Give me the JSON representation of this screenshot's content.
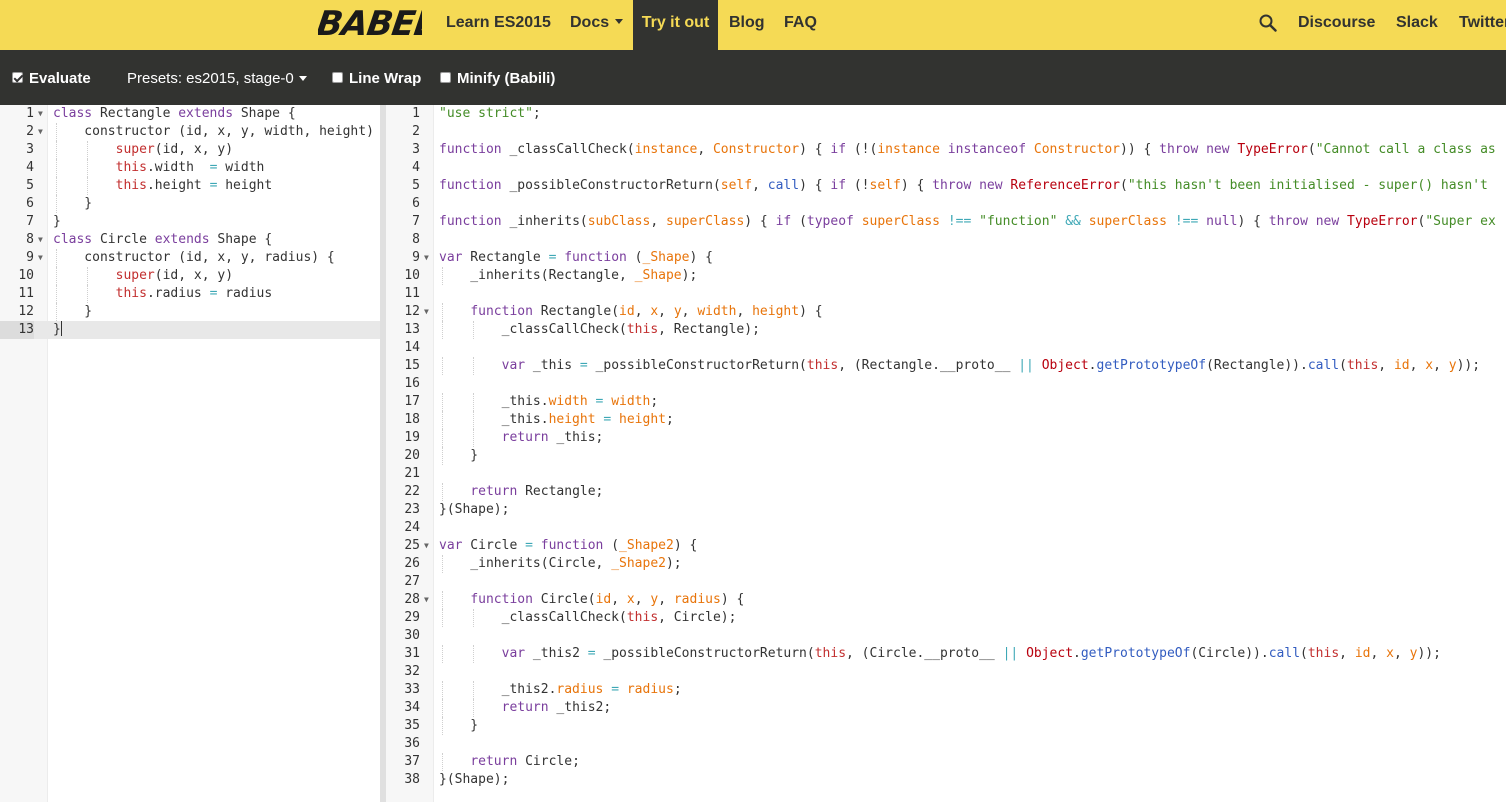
{
  "brand": {
    "logo_text": "BABEL"
  },
  "nav": {
    "items": [
      {
        "label": "Learn ES2015"
      },
      {
        "label": "Docs"
      },
      {
        "label": "Try it out"
      },
      {
        "label": "Blog"
      },
      {
        "label": "FAQ"
      }
    ],
    "right_items": [
      {
        "label": "Discourse"
      },
      {
        "label": "Slack"
      },
      {
        "label": "Twitter"
      }
    ]
  },
  "toolbar": {
    "evaluate_label": "Evaluate",
    "evaluate_checked": true,
    "presets_label": "Presets: es2015, stage-0",
    "line_wrap_label": "Line Wrap",
    "line_wrap_checked": false,
    "minify_label": "Minify (Babili)",
    "minify_checked": false
  },
  "colors": {
    "nav_bg": "#f5da55",
    "nav_text": "#323330",
    "toolbar_bg": "#323330",
    "active_tab_text": "#f5da55"
  },
  "input_editor": {
    "active_line": 13,
    "lines": [
      {
        "n": "1",
        "fold": true,
        "code": "class Rectangle extends Shape {"
      },
      {
        "n": "2",
        "fold": true,
        "code": "    constructor (id, x, y, width, height) {"
      },
      {
        "n": "3",
        "fold": false,
        "code": "        super(id, x, y)"
      },
      {
        "n": "4",
        "fold": false,
        "code": "        this.width  = width"
      },
      {
        "n": "5",
        "fold": false,
        "code": "        this.height = height"
      },
      {
        "n": "6",
        "fold": false,
        "code": "    }"
      },
      {
        "n": "7",
        "fold": false,
        "code": "}"
      },
      {
        "n": "8",
        "fold": true,
        "code": "class Circle extends Shape {"
      },
      {
        "n": "9",
        "fold": true,
        "code": "    constructor (id, x, y, radius) {"
      },
      {
        "n": "10",
        "fold": false,
        "code": "        super(id, x, y)"
      },
      {
        "n": "11",
        "fold": false,
        "code": "        this.radius = radius"
      },
      {
        "n": "12",
        "fold": false,
        "code": "    }"
      },
      {
        "n": "13",
        "fold": false,
        "code": "}"
      }
    ]
  },
  "output_editor": {
    "lines": [
      {
        "n": "1",
        "fold": false,
        "code": "\"use strict\";"
      },
      {
        "n": "2",
        "fold": false,
        "code": ""
      },
      {
        "n": "3",
        "fold": false,
        "code": "function _classCallCheck(instance, Constructor) { if (!(instance instanceof Constructor)) { throw new TypeError(\"Cannot call a class as"
      },
      {
        "n": "4",
        "fold": false,
        "code": ""
      },
      {
        "n": "5",
        "fold": false,
        "code": "function _possibleConstructorReturn(self, call) { if (!self) { throw new ReferenceError(\"this hasn't been initialised - super() hasn't"
      },
      {
        "n": "6",
        "fold": false,
        "code": ""
      },
      {
        "n": "7",
        "fold": false,
        "code": "function _inherits(subClass, superClass) { if (typeof superClass !== \"function\" && superClass !== null) { throw new TypeError(\"Super ex"
      },
      {
        "n": "8",
        "fold": false,
        "code": ""
      },
      {
        "n": "9",
        "fold": true,
        "code": "var Rectangle = function (_Shape) {"
      },
      {
        "n": "10",
        "fold": false,
        "code": "    _inherits(Rectangle, _Shape);"
      },
      {
        "n": "11",
        "fold": false,
        "code": ""
      },
      {
        "n": "12",
        "fold": true,
        "code": "    function Rectangle(id, x, y, width, height) {"
      },
      {
        "n": "13",
        "fold": false,
        "code": "        _classCallCheck(this, Rectangle);"
      },
      {
        "n": "14",
        "fold": false,
        "code": ""
      },
      {
        "n": "15",
        "fold": false,
        "code": "        var _this = _possibleConstructorReturn(this, (Rectangle.__proto__ || Object.getPrototypeOf(Rectangle)).call(this, id, x, y));"
      },
      {
        "n": "16",
        "fold": false,
        "code": ""
      },
      {
        "n": "17",
        "fold": false,
        "code": "        _this.width = width;"
      },
      {
        "n": "18",
        "fold": false,
        "code": "        _this.height = height;"
      },
      {
        "n": "19",
        "fold": false,
        "code": "        return _this;"
      },
      {
        "n": "20",
        "fold": false,
        "code": "    }"
      },
      {
        "n": "21",
        "fold": false,
        "code": ""
      },
      {
        "n": "22",
        "fold": false,
        "code": "    return Rectangle;"
      },
      {
        "n": "23",
        "fold": false,
        "code": "}(Shape);"
      },
      {
        "n": "24",
        "fold": false,
        "code": ""
      },
      {
        "n": "25",
        "fold": true,
        "code": "var Circle = function (_Shape2) {"
      },
      {
        "n": "26",
        "fold": false,
        "code": "    _inherits(Circle, _Shape2);"
      },
      {
        "n": "27",
        "fold": false,
        "code": ""
      },
      {
        "n": "28",
        "fold": true,
        "code": "    function Circle(id, x, y, radius) {"
      },
      {
        "n": "29",
        "fold": false,
        "code": "        _classCallCheck(this, Circle);"
      },
      {
        "n": "30",
        "fold": false,
        "code": ""
      },
      {
        "n": "31",
        "fold": false,
        "code": "        var _this2 = _possibleConstructorReturn(this, (Circle.__proto__ || Object.getPrototypeOf(Circle)).call(this, id, x, y));"
      },
      {
        "n": "32",
        "fold": false,
        "code": ""
      },
      {
        "n": "33",
        "fold": false,
        "code": "        _this2.radius = radius;"
      },
      {
        "n": "34",
        "fold": false,
        "code": "        return _this2;"
      },
      {
        "n": "35",
        "fold": false,
        "code": "    }"
      },
      {
        "n": "36",
        "fold": false,
        "code": ""
      },
      {
        "n": "37",
        "fold": false,
        "code": "    return Circle;"
      },
      {
        "n": "38",
        "fold": false,
        "code": "}(Shape);"
      }
    ]
  }
}
